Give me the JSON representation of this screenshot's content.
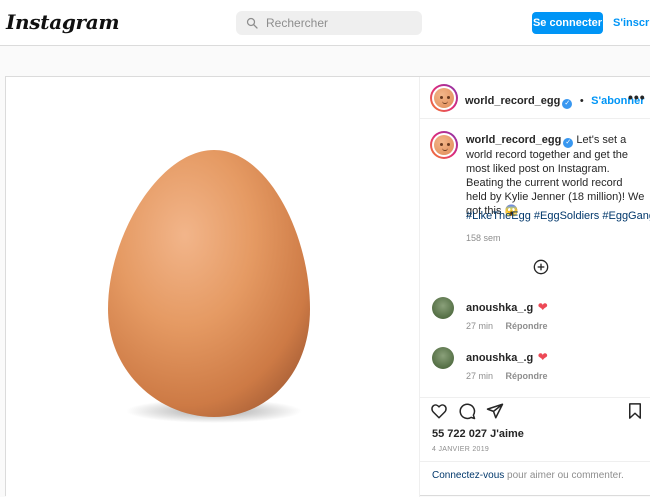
{
  "header": {
    "logo": "Instagram",
    "search_placeholder": "Rechercher",
    "login_button": "Se connecter",
    "signup_link": "S'inscrire"
  },
  "post": {
    "username": "world_record_egg",
    "follow_label": "S'abonner",
    "more_label": "•••",
    "caption": "Let's set a world record together and get the most liked post on Instagram. Beating the current world record held by Kylie Jenner (18 million)! We got this 😱",
    "hashtags": "#LikeTheEgg #EggSoldiers #EggGang",
    "caption_time": "158 sem",
    "comments": [
      {
        "username": "anoushka_.g",
        "time": "27 min",
        "reply": "Répondre"
      },
      {
        "username": "anoushka_.g",
        "time": "27 min",
        "reply": "Répondre"
      }
    ],
    "likes": "55 722 027 J'aime",
    "date": "4 JANVIER 2019",
    "login_prompt_link": "Connectez-vous",
    "login_prompt_rest": " pour aimer ou commenter."
  },
  "colors": {
    "accent": "#0095f6",
    "egg": "#e08a55"
  }
}
